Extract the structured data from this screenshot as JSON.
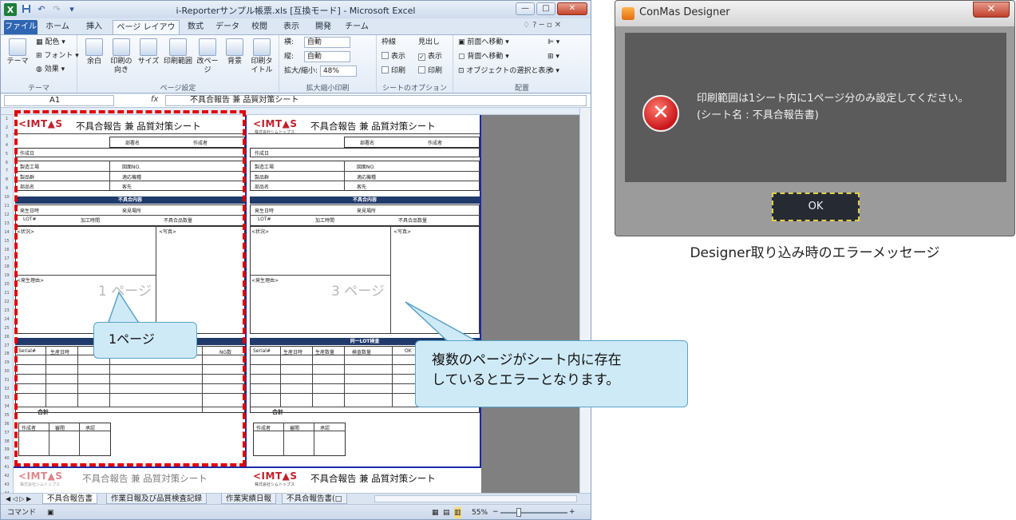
{
  "excel": {
    "window_title": "i-Reporterサンプル帳票.xls [互換モード] - Microsoft Excel",
    "qat_icons": [
      "excel-logo-icon",
      "save-icon",
      "undo-icon",
      "redo-icon"
    ],
    "logo_letter": "X",
    "win_min": "—",
    "win_max": "□",
    "win_close": "✕",
    "ribbon_tabs": [
      "ファイル",
      "ホーム",
      "挿入",
      "ページ レイアウト",
      "数式",
      "データ",
      "校閲",
      "表示",
      "開発",
      "チーム"
    ],
    "help_marks": "♢ ? ─ ▫ ✕",
    "groups": {
      "theme": {
        "label": "テーマ",
        "theme_btn": "テーマ",
        "colors": "配色 ▾",
        "fonts": "フォント ▾",
        "effects": "効果 ▾"
      },
      "page_setup": {
        "label": "ページ設定",
        "margins": "余白",
        "orientation": "印刷の向き",
        "size": "サイズ",
        "print_area": "印刷範囲",
        "breaks": "改ページ",
        "background": "背景",
        "print_titles": "印刷タイトル"
      },
      "scale": {
        "label": "拡大縮小印刷",
        "width_label": "横:",
        "width_value": "自動",
        "height_label": "縦:",
        "height_value": "自動",
        "scale_label": "拡大/縮小:",
        "scale_value": "48%"
      },
      "sheet_options": {
        "label": "シートのオプション",
        "gridlines": "枠線",
        "headings": "見出し",
        "view": "表示",
        "print": "印刷"
      },
      "arrange": {
        "label": "配置",
        "bring_forward": "前面へ移動 ▾",
        "send_backward": "背面へ移動 ▾",
        "selection_pane": "オブジェクトの選択と表示"
      }
    },
    "name_box": "A1",
    "fx_label": "fx",
    "formula": "不具合報告 兼 品質対策シート",
    "form": {
      "logo": "<IMT▲S",
      "logo_sub": "株式会社シムトップス",
      "title": "不具合報告 兼 品質対策シート",
      "dept": "部署名",
      "author": "作成者",
      "created": "作成日",
      "factory": "製造工場",
      "drawing_no": "図面NO.",
      "product": "製品群",
      "model": "適応機種",
      "part": "部品名",
      "customer": "客先",
      "defect_header": "不具合内容",
      "occurred_date": "発生日時",
      "place": "発見場所",
      "lot": "LOT#",
      "process_time": "加工時間",
      "defect_qty": "不具合品数量",
      "situation": "<状況>",
      "photo": "<写真>",
      "cause": "<発生理由>",
      "same_lot": "同一LOT検査",
      "serial": "Serial#",
      "prod_date": "生産日時",
      "prod_qty": "生産数量",
      "insp_qty": "検査数量",
      "ng": "NG数",
      "ok_count": "OK",
      "total": "合計",
      "approve_author": "作成者",
      "approve_check": "審閲",
      "approve_ok": "承認"
    },
    "page_wm_1": "1 ページ",
    "page_wm_3": "3 ページ",
    "sheet_tabs": [
      "不具合報告書",
      "作業日報及び品質検査記録",
      "作業実績日報",
      "不具合報告書(□"
    ],
    "status_mode": "コマンド",
    "zoom": "55%",
    "zoom_minus": "−",
    "zoom_plus": "+"
  },
  "callouts": {
    "page1": "1ページ",
    "error_line1": "複数のページがシート内に存在",
    "error_line2": "しているとエラーとなります。"
  },
  "designer": {
    "title": "ConMas Designer",
    "close": "✕",
    "msg_line1": "印刷範囲は1シート内に1ページ分のみ設定してください。",
    "msg_line2": "(シート名 : 不具合報告書)",
    "ok": "OK",
    "caption": "Designer取り込み時のエラーメッセージ"
  },
  "colors": {
    "error_red": "#e00000",
    "callout_fill": "#cfeaf7",
    "callout_border": "#5aa3c9",
    "page_border": "#1a2aa8",
    "dialog_panel": "#5b5b5b"
  }
}
